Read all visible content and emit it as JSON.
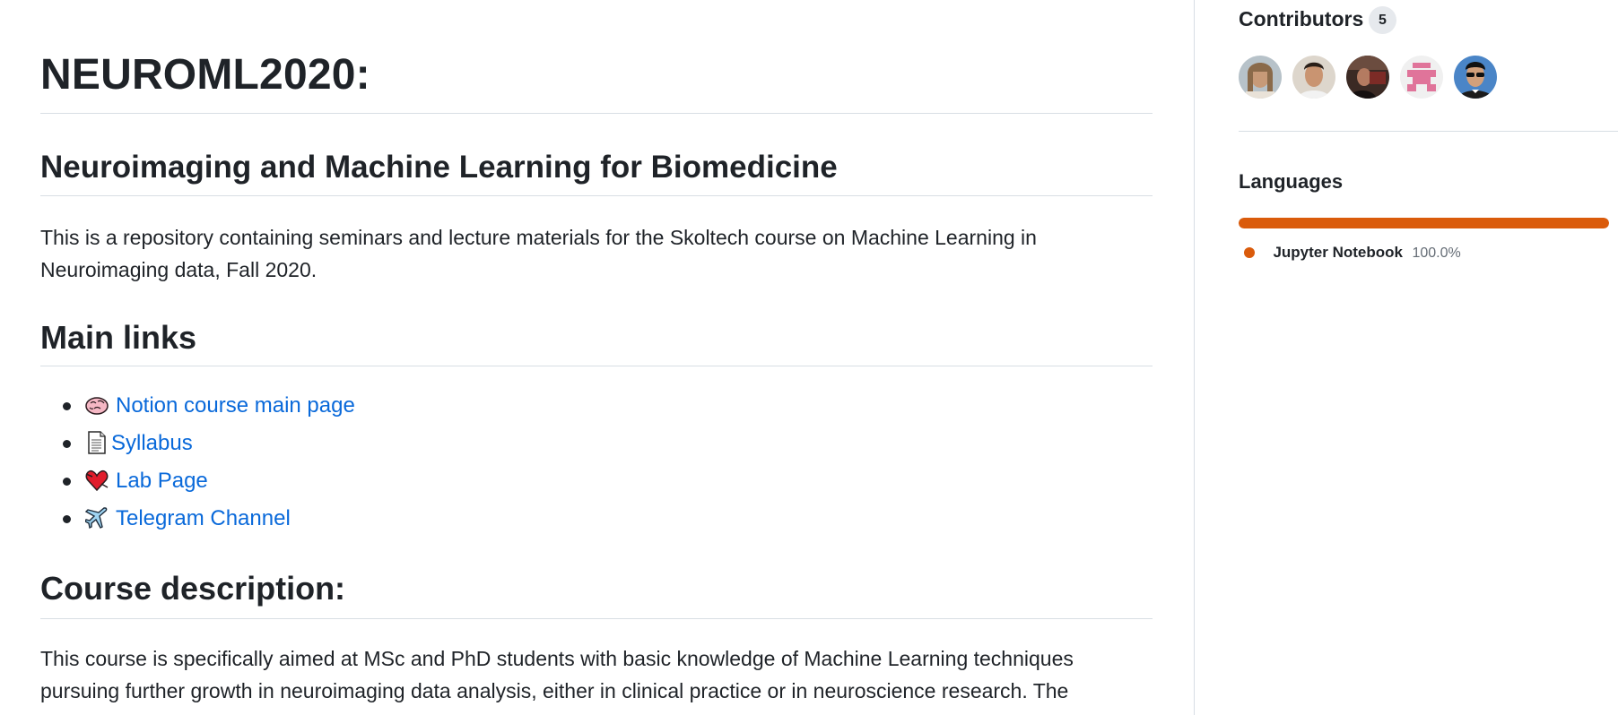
{
  "readme": {
    "title": "NEUROML2020:",
    "subtitle": "Neuroimaging and Machine Learning for Biomedicine",
    "intro": "This is a repository containing seminars and lecture materials for the Skoltech course on Machine Learning in Neuroimaging data, Fall 2020.",
    "main_links_heading": "Main links",
    "links": [
      {
        "icon": "brain-icon",
        "label": "Notion course main page"
      },
      {
        "icon": "page-icon",
        "label": "Syllabus"
      },
      {
        "icon": "heart-icon",
        "label": "Lab Page"
      },
      {
        "icon": "airplane-icon",
        "label": "Telegram Channel"
      }
    ],
    "course_description_heading": "Course description:",
    "course_description": "This course is specifically aimed at MSc and PhD students with basic knowledge of Machine Learning techniques pursuing further growth in neuroimaging data analysis, either in clinical practice or in neuroscience research. The"
  },
  "sidebar": {
    "contributors": {
      "title": "Contributors",
      "count": "5",
      "avatars": [
        {
          "name": "contributor-avatar-1"
        },
        {
          "name": "contributor-avatar-2"
        },
        {
          "name": "contributor-avatar-3"
        },
        {
          "name": "contributor-avatar-4"
        },
        {
          "name": "contributor-avatar-5"
        }
      ]
    },
    "languages": {
      "title": "Languages",
      "items": [
        {
          "name": "Jupyter Notebook",
          "percent": "100.0%",
          "fraction": 1.0,
          "color": "#DA5B0B"
        }
      ]
    }
  },
  "colors": {
    "link": "#0969da",
    "text": "#1f2328",
    "border": "#d8dee4"
  }
}
